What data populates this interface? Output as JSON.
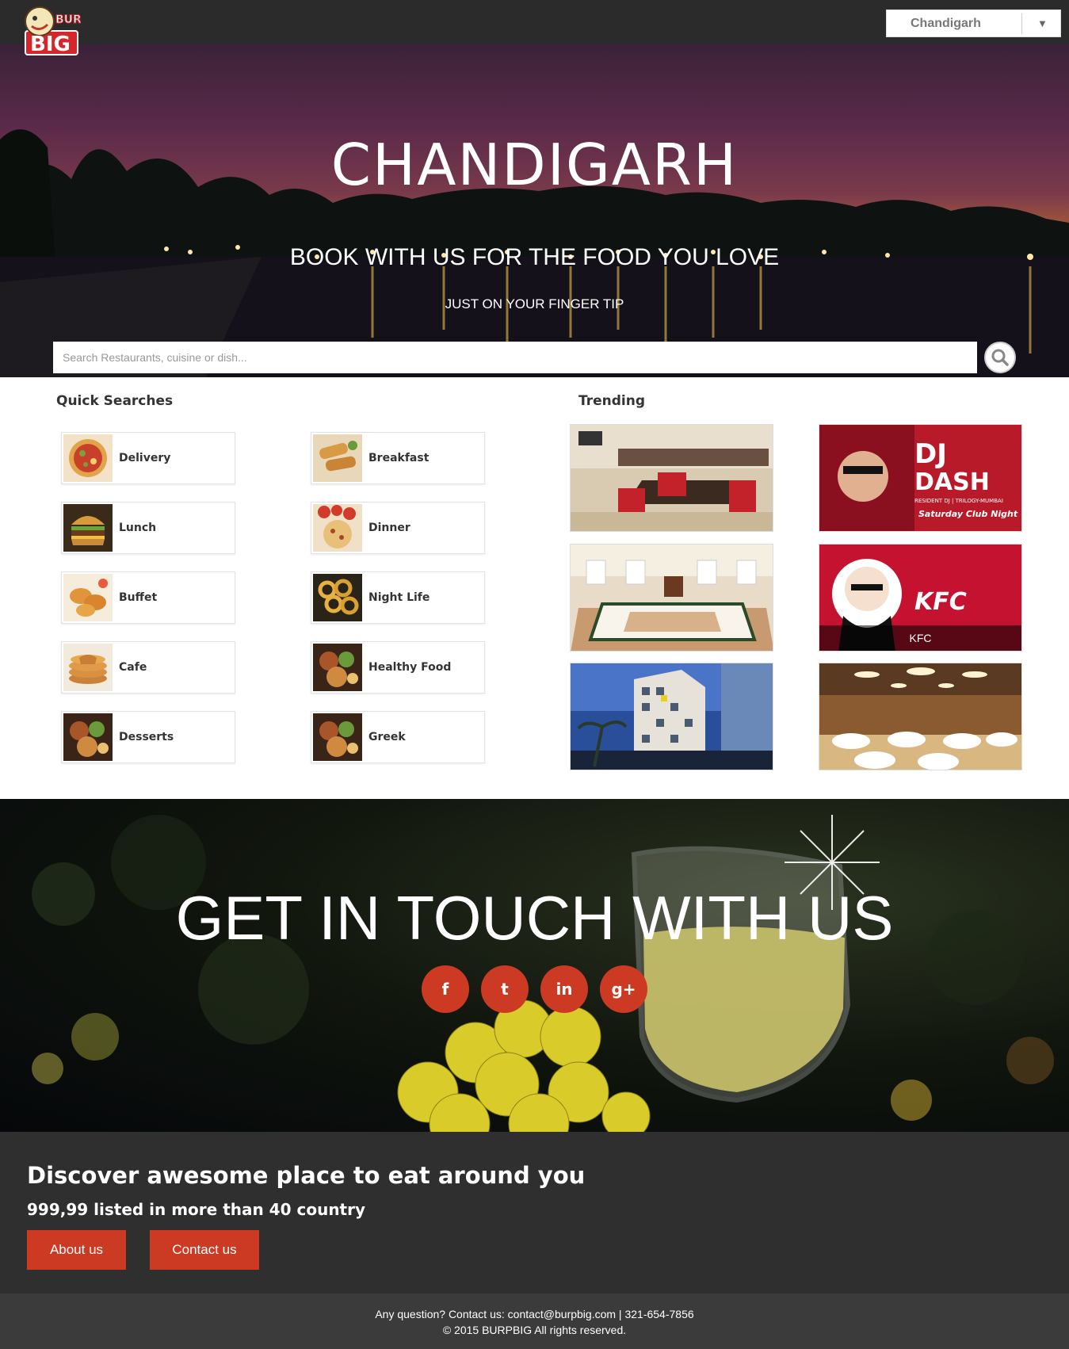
{
  "header": {
    "logo_top": "BURP",
    "logo_bottom": "BIG",
    "city_selected": "Chandigarh",
    "dropdown_arrow": "▼"
  },
  "hero": {
    "title": "CHANDIGARH",
    "subtitle": "BOOK WITH US FOR THE FOOD YOU LOVE",
    "tagline": "JUST ON YOUR FINGER TIP",
    "search_placeholder": "Search Restaurants, cuisine or dish...",
    "search_icon": "search-icon"
  },
  "quick_searches": {
    "title": "Quick Searches",
    "items": [
      {
        "label": "Delivery"
      },
      {
        "label": "Breakfast"
      },
      {
        "label": "Lunch"
      },
      {
        "label": "Dinner"
      },
      {
        "label": "Buffet"
      },
      {
        "label": "Night Life"
      },
      {
        "label": "Cafe"
      },
      {
        "label": "Healthy Food"
      },
      {
        "label": "Desserts"
      },
      {
        "label": "Greek"
      }
    ]
  },
  "trending": {
    "title": "Trending",
    "cards": [
      {
        "caption": ""
      },
      {
        "caption": "",
        "poster_line1": "DJ",
        "poster_line2": "DASH",
        "poster_line3": "RESIDENT DJ | TRILOGY-MUMBAI",
        "poster_line4": "Saturday Club Night"
      },
      {
        "caption": ""
      },
      {
        "caption": "KFC",
        "logo_text": "KFC"
      },
      {
        "caption": ""
      },
      {
        "caption": ""
      }
    ]
  },
  "contact": {
    "title": "GET IN TOUCH WITH US",
    "social": [
      {
        "glyph": "f",
        "icon": "facebook-icon"
      },
      {
        "glyph": "t",
        "icon": "twitter-icon"
      },
      {
        "glyph": "in",
        "icon": "linkedin-icon"
      },
      {
        "glyph": "g+",
        "icon": "google-plus-icon"
      }
    ]
  },
  "discover": {
    "title": "Discover awesome place to eat around you",
    "subtitle": "999,99 listed in more than 40 country",
    "about_label": "About us",
    "contact_label": "Contact us"
  },
  "footer": {
    "line1": "Any question? Contact us: contact@burpbig.com | 321-654-7856",
    "line2": "© 2015 BURPBIG All rights reserved."
  },
  "colors": {
    "accent": "#cc3a24",
    "topbar": "#2b2b2b",
    "discover_bg": "#2f2f2f",
    "footer_bg": "#3b3b3b"
  }
}
